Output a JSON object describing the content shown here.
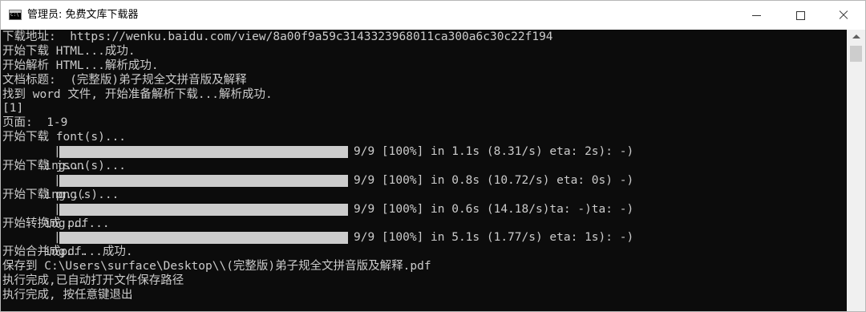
{
  "window": {
    "title": "管理员: 免费文库下载器"
  },
  "console": {
    "lines": [
      "下载地址:  https://wenku.baidu.com/view/8a00f9a59c3143323968011ca300a6c30c22f194",
      "开始下载 HTML...成功.",
      "开始解析 HTML...解析成功.",
      "文档标题:  (完整版)弟子规全文拼音版及解释",
      "找到 word 文件, 开始准备解析下载...解析成功.",
      "[1]",
      "页面:  1-9",
      "开始下载 font(s)...",
      "开始下载 json(s)...",
      "开始下载 png(s)...",
      "开始转换成 pdf...",
      "开始合并成pdf...成功.",
      "保存到 C:\\Users\\surface\\Desktop\\\\(完整版)弟子规全文拼音版及解释.pdf",
      "执行完成,已自动打开文件保存路径",
      "执行完成, 按任意键退出"
    ],
    "progress": [
      {
        "label": "ing...",
        "open": "|",
        "percent": 100,
        "stats": "9/9 [100%] in 1.1s (8.31/s) eta: 2s): -)"
      },
      {
        "label": "ing...",
        "open": "|",
        "percent": 100,
        "stats": "9/9 [100%] in 0.8s (10.72/s) eta: 0s) -)"
      },
      {
        "label": "ing...",
        "open": "|",
        "percent": 100,
        "stats": "9/9 [100%] in 0.6s (14.18/s)ta: -)ta: -)"
      },
      {
        "label": "ing...",
        "open": "|",
        "percent": 100,
        "stats": "9/9 [100%] in 5.1s (1.77/s) eta: 1s): -)"
      }
    ]
  },
  "colors": {
    "console_bg": "#0c0c0c",
    "console_text": "#cccccc",
    "progress_fill": "#cccccc"
  },
  "icons": {
    "app": "console-icon",
    "minimize": "minimize-icon",
    "maximize": "maximize-icon",
    "close": "close-icon",
    "scroll_up": "scroll-up-arrow-icon"
  }
}
